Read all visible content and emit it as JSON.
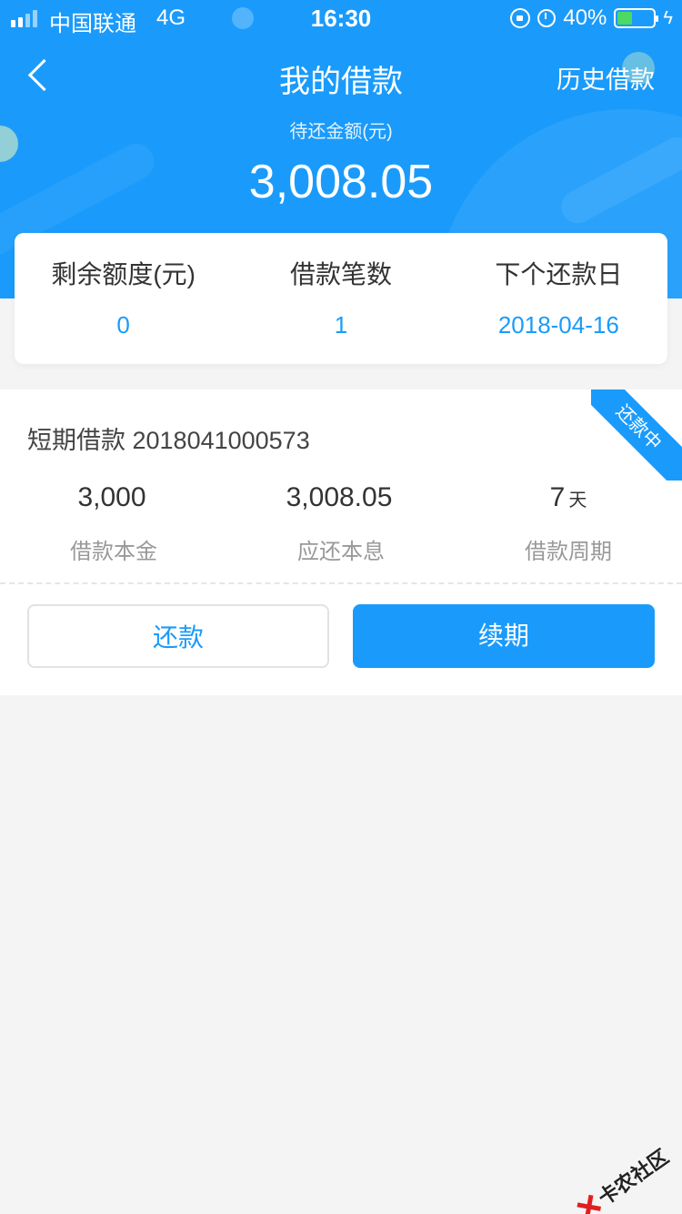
{
  "status_bar": {
    "carrier": "中国联通",
    "network": "4G",
    "time": "16:30",
    "battery_text": "40%",
    "battery_level": 0.4,
    "battery_color": "#4cd964"
  },
  "nav": {
    "back_icon": "chevron-left-icon",
    "title": "我的借款",
    "history_label": "历史借款"
  },
  "header": {
    "due_label": "待还金额(元)",
    "due_amount": "3,008.05",
    "background_color": "#1a9bfb"
  },
  "summary": {
    "items": [
      {
        "label": "剩余额度(元)",
        "value": "0"
      },
      {
        "label": "借款笔数",
        "value": "1"
      },
      {
        "label": "下个还款日",
        "value": "2018-04-16"
      }
    ]
  },
  "loan": {
    "title": "短期借款 2018041000573",
    "status_badge": "还款中",
    "stats": [
      {
        "value": "3,000",
        "unit": "",
        "label": "借款本金"
      },
      {
        "value": "3,008.05",
        "unit": "",
        "label": "应还本息"
      },
      {
        "value": "7",
        "unit": "天",
        "label": "借款周期"
      }
    ],
    "repay_label": "还款",
    "renew_label": "续期"
  },
  "watermark": {
    "text": "卡农社区"
  },
  "colors": {
    "accent": "#1a9bfb",
    "page_bg": "#f4f4f4"
  }
}
